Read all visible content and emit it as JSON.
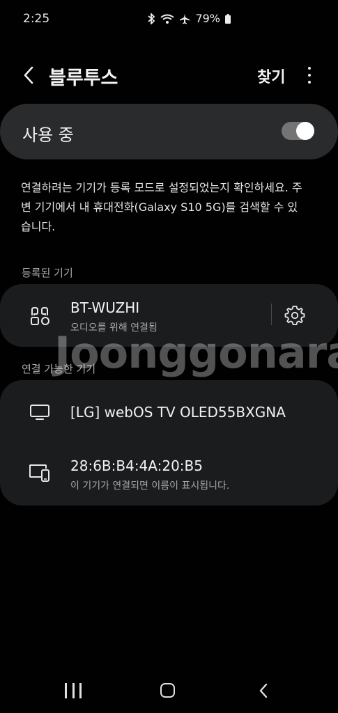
{
  "status_bar": {
    "time": "2:25",
    "battery": "79%"
  },
  "header": {
    "title": "블루투스",
    "search_label": "찾기"
  },
  "master_switch": {
    "label": "사용 중",
    "on": true
  },
  "description": "연결하려는 기기가 등록 모드로 설정되었는지 확인하세요. 주변 기기에서 내 휴대전화(Galaxy S10 5G)를 검색할 수 있습니다.",
  "registered": {
    "header": "등록된 기기",
    "devices": [
      {
        "name": "BT-WUZHI",
        "status": "오디오를 위해 연결됨",
        "icon": "earbuds-icon"
      }
    ]
  },
  "available": {
    "header": "연결 가능한 기기",
    "devices": [
      {
        "name": "[LG] webOS TV OLED55BXGNA",
        "icon": "tv-icon"
      },
      {
        "name": "28:6B:B4:4A:20:B5",
        "status": "이 기기가 연결되면 이름이 표시됩니다.",
        "icon": "phone-tablet-icon"
      }
    ]
  },
  "watermark": "Joonggonara",
  "colors": {
    "background": "#010101",
    "card": "#1b1c1e",
    "switch_card": "#2a2b2d"
  }
}
